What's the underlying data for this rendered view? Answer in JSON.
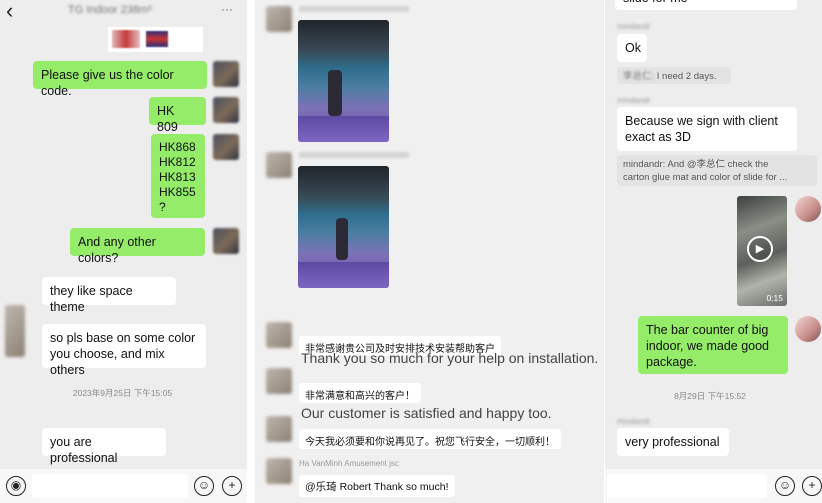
{
  "p1": {
    "back": "‹",
    "title": "TG Indoor 238m²",
    "more": "···",
    "msg1": "Please give us the color code.",
    "msg2": "HK 809",
    "msg3": "HK868\nHK812\nHK813\nHK855\n?",
    "msg4": "And any other colors?",
    "msg5": "they like space theme",
    "msg6": "so pls base on some color\nyou choose, and mix others",
    "time1": "2023年9月25日 下午15:05",
    "msg7": "you are professional"
  },
  "p2": {
    "cn1": "非常感谢贵公司及时安排技术安装帮助客户",
    "en1": "Thank you so much for your help on installation.",
    "cn2": "非常满意和高兴的客户！",
    "en2": "Our customer is satisfied and happy too.",
    "cn3": "今天我必须要和你说再见了。祝您飞行安全，一切顺利！",
    "sender": "Ha VanMinh Amusement jsc",
    "cn4": "@乐琦  Robert Thank so much!"
  },
  "p3": {
    "top": "slide for me",
    "sender1": "mindandr",
    "msg1": "Ok",
    "quote1_name": "李总仁:",
    "quote1_text": "I need 2 days.",
    "sender2": "mindandr",
    "msg2": "Because we sign with client\nexact as 3D",
    "quote2": "mindandr: And @李总仁 check the\ncarton glue mat and color of slide for ...",
    "duration": "0:15",
    "msg3": "The bar counter of big\nindoor, we made good\npackage.",
    "time1": "8月29日 下午15:52",
    "sender3": "mindandr",
    "msg4": "very professional"
  }
}
